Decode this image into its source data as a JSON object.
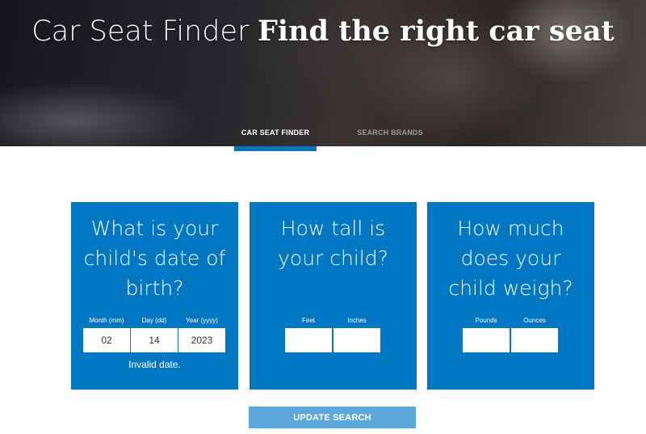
{
  "hero": {
    "title_light": "Car Seat Finder",
    "title_bold": "Find the right car seat"
  },
  "tabs": [
    {
      "label": "CAR SEAT FINDER",
      "active": true
    },
    {
      "label": "SEARCH BRANDS",
      "active": false
    }
  ],
  "colors": {
    "accent": "#0077c2",
    "button": "#5aa8dc"
  },
  "cards": {
    "dob": {
      "question": "What is your child's date of birth?",
      "month_label": "Month (mm)",
      "day_label": "Day (dd)",
      "year_label": "Year (yyyy)",
      "month_value": "02",
      "day_value": "14",
      "year_value": "2023",
      "error": "Invalid date."
    },
    "height": {
      "question": "How tall is your child?",
      "feet_label": "Feet",
      "inches_label": "Inches",
      "feet_value": "",
      "inches_value": ""
    },
    "weight": {
      "question": "How much does your child weigh?",
      "pounds_label": "Pounds",
      "ounces_label": "Ounces",
      "pounds_value": "",
      "ounces_value": ""
    }
  },
  "button": {
    "label": "UPDATE SEARCH"
  }
}
